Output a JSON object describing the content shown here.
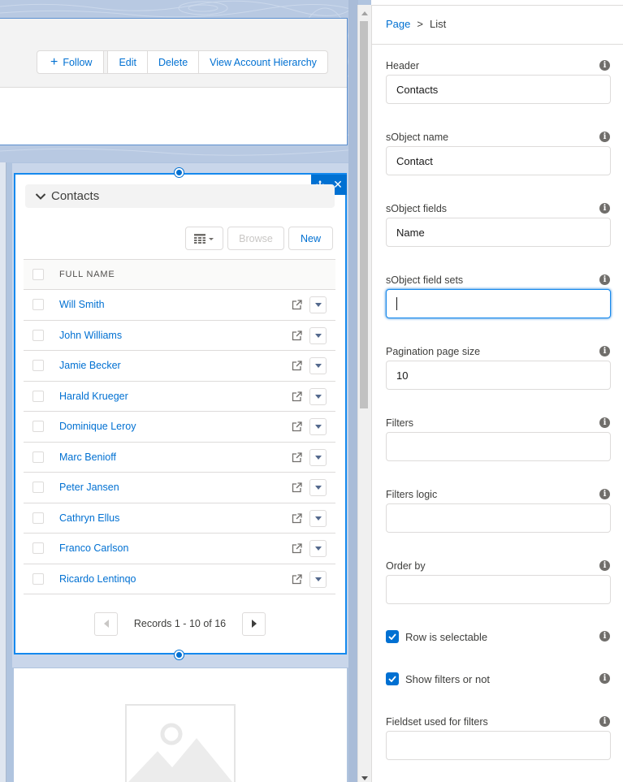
{
  "header_actions": {
    "follow": "Follow",
    "edit": "Edit",
    "delete": "Delete",
    "hierarchy": "View Account Hierarchy"
  },
  "contacts_component": {
    "title": "Contacts",
    "actions": {
      "browse": "Browse",
      "new": "New"
    },
    "column_header": "FULL NAME",
    "rows": [
      "Will Smith",
      "John Williams",
      "Jamie Becker",
      "Harald Krueger",
      "Dominique Leroy",
      "Marc Benioff",
      "Peter Jansen",
      "Cathryn Ellus",
      "Franco Carlson",
      "Ricardo Lentinqo"
    ],
    "pagination": "Records 1 - 10 of 16"
  },
  "panel": {
    "breadcrumb": {
      "root": "Page",
      "separator": ">",
      "current": "List"
    },
    "fields": {
      "header": {
        "label": "Header",
        "value": "Contacts"
      },
      "sobject_name": {
        "label": "sObject name",
        "value": "Contact"
      },
      "sobject_fields": {
        "label": "sObject fields",
        "value": "Name"
      },
      "sobject_field_sets": {
        "label": "sObject field sets",
        "value": ""
      },
      "pagination_page_size": {
        "label": "Pagination page size",
        "value": "10"
      },
      "filters": {
        "label": "Filters",
        "value": ""
      },
      "filters_logic": {
        "label": "Filters logic",
        "value": ""
      },
      "order_by": {
        "label": "Order by",
        "value": ""
      },
      "fieldset_for_filters": {
        "label": "Fieldset used for filters",
        "value": ""
      }
    },
    "checkboxes": {
      "row_selectable": {
        "label": "Row is selectable",
        "checked": true
      },
      "show_filters": {
        "label": "Show filters or not",
        "checked": true
      }
    },
    "info_icon": "i"
  },
  "colors": {
    "brand": "#0070d2",
    "selection": "#1589ee",
    "canvas_bg": "#b0c4df"
  }
}
